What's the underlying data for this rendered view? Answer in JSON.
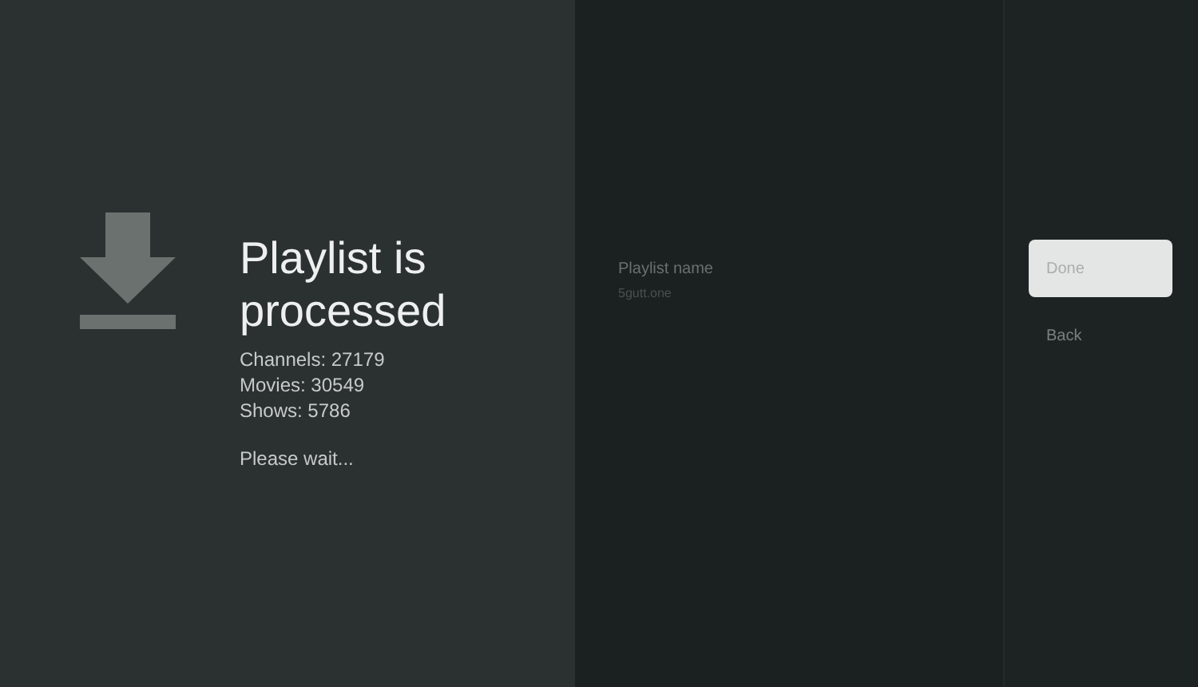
{
  "header": {
    "title": "Playlist is processed",
    "stats": [
      "Channels: 27179",
      "Movies: 30549",
      "Shows: 5786"
    ],
    "status": "Please wait..."
  },
  "details": {
    "label": "Playlist name",
    "value": "5gutt.one"
  },
  "actions": [
    {
      "label": "Done",
      "selected": true
    },
    {
      "label": "Back",
      "selected": false
    }
  ]
}
